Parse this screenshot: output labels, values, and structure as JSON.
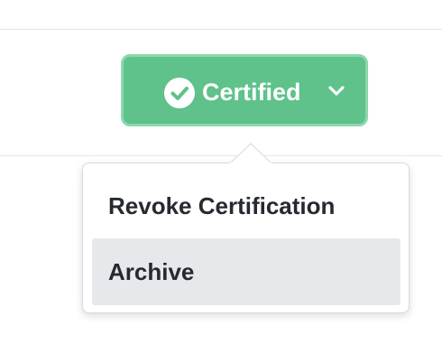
{
  "certification_button": {
    "label": "Certified",
    "status_icon": "check-circle-icon",
    "dropdown_icon": "chevron-down-icon",
    "color": "#5ec28a"
  },
  "dropdown_menu": {
    "items": [
      {
        "label": "Revoke Certification",
        "highlighted": false
      },
      {
        "label": "Archive",
        "highlighted": true
      }
    ]
  }
}
